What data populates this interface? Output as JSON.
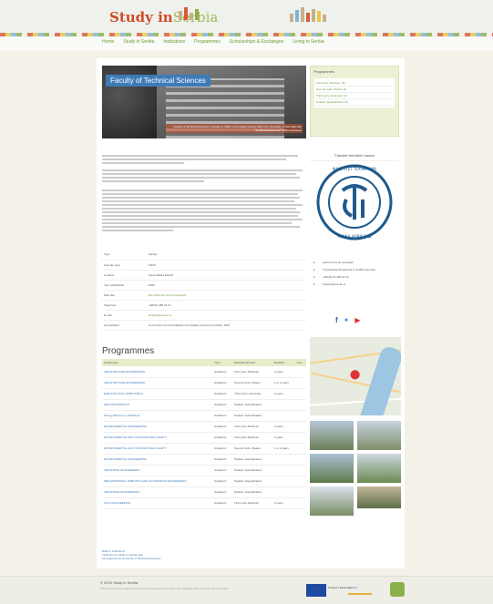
{
  "site": {
    "logo_main": "Study in",
    "logo_sub": "Serbia"
  },
  "nav": [
    "Home",
    "Study in Serbia",
    "Institutions",
    "Programmes",
    "Scholarships & Exchanges",
    "Living in Serbia"
  ],
  "hero": {
    "title": "Faculty of Technical Sciences",
    "caption": "Faculty of Technical Sciences, founded in 1960, is the largest faculty within the University of Novi Sad with 14,000 students and 1,200 employees"
  },
  "programmes_box": {
    "title": "Programmes",
    "items": [
      "First cycle: Bachelor (8)",
      "Second cycle: Master (9)",
      "Third cycle: Doctorate (4)",
      "Studies: Specialization (3)"
    ]
  },
  "sidebar": {
    "title": "Fakultet tehničkih nauka",
    "seal_text_left": "ФАКУЛТЕТ ТЕХНИЧКИХ",
    "seal_text_right": "НАУКА НОВИ САД",
    "contact": [
      {
        "icon": "globe-icon",
        "text": "www.ftn.uns.ac.rs/english"
      },
      {
        "icon": "location-icon",
        "text": "Trg Dositeja Obradovića 6, 21000 Novi Sad"
      },
      {
        "icon": "phone-icon",
        "text": "+381(0) 21 485 22 22"
      },
      {
        "icon": "mail-icon",
        "text": "ftndean@uns.ac.rs"
      }
    ]
  },
  "info": [
    [
      "Type",
      "Faculty"
    ],
    [
      "Founder type",
      "Public"
    ],
    [
      "Location",
      "South Bačka District"
    ],
    [
      "Year established",
      "1960"
    ],
    [
      "Web site",
      "http://www.ftn.uns.ac.rs/english"
    ],
    [
      "Telephone",
      "+381(0) 485 22 22"
    ],
    [
      "E-mail",
      "ftndean@uns.ac.rs"
    ],
    [
      "Accreditation",
      "Commission for Accreditation and Quality Assurance (CAQA), 2007"
    ]
  ],
  "programmes_title": "Programmes",
  "programmes_table": {
    "headers": [
      "Programme",
      "Type",
      "Educational level",
      "Duration",
      "Fee"
    ],
    "rows": [
      [
        "ARCHITECTURE ENGINEERING",
        "Academic",
        "First cycle: Bachelor",
        "4 years",
        ""
      ],
      [
        "ARCHITECTURE ENGINEERING",
        "Academic",
        "Second cycle: Master",
        "1 or 2 years",
        ""
      ],
      [
        "ELECTRIC AND COMPUTER E.",
        "Academic",
        "Third cycle: Doctorate",
        "3 years",
        ""
      ],
      [
        "GEO INFORMATICS",
        "Academic",
        "Studies: Specialization",
        "",
        ""
      ],
      [
        "Energy Efficiency in Buildings",
        "Academic",
        "Studies: Specialization",
        "",
        ""
      ],
      [
        "ENVIRONMENTAL ENGINEERING",
        "Academic",
        "First cycle: Bachelor",
        "4 years",
        ""
      ],
      [
        "ENVIRONMENTAL AND OCCUPATIONAL SAFETY",
        "Academic",
        "First cycle: Bachelor",
        "4 years",
        ""
      ],
      [
        "ENVIRONMENTAL AND OCCUPATIONAL SAFETY",
        "Academic",
        "Second cycle: Master",
        "1 or 2 years",
        ""
      ],
      [
        "ENVIRONMENTAL ENGINEERING",
        "Academic",
        "Studies: Specialization",
        "",
        ""
      ],
      [
        "INDUSTRIAL ENGINEERING",
        "Academic",
        "Studies: Specialization",
        "",
        ""
      ],
      [
        "MECHATRONICS, ROBOTICS AND AUTOMATION ENGINEERING",
        "Academic",
        "Studies: Specialization",
        "",
        ""
      ],
      [
        "INDUSTRIAL ENGINEERING",
        "Academic",
        "Studies: Specialization",
        "",
        ""
      ],
      [
        "CIVIL ENGINEERING",
        "Academic",
        "First cycle: Bachelor",
        "4 years",
        ""
      ]
    ]
  },
  "footer_links": [
    "Back to Institutions",
    "Institution on Study in Serbia map",
    "All programmes at Faculty of Technical Sciences"
  ],
  "footer": {
    "copyright": "© 2015 Study in Serbia",
    "fine": "This project has been funded with support from the European Commission. This publication reflects the views only of the author.",
    "eu_label": "Tempus / Erasmus+",
    "partner_label": "Serbian"
  },
  "colors": {
    "accent": "#6a9a3a",
    "brand": "#d34a2b",
    "link": "#3d7bb8",
    "hero_tag": "#3d7bb8"
  }
}
